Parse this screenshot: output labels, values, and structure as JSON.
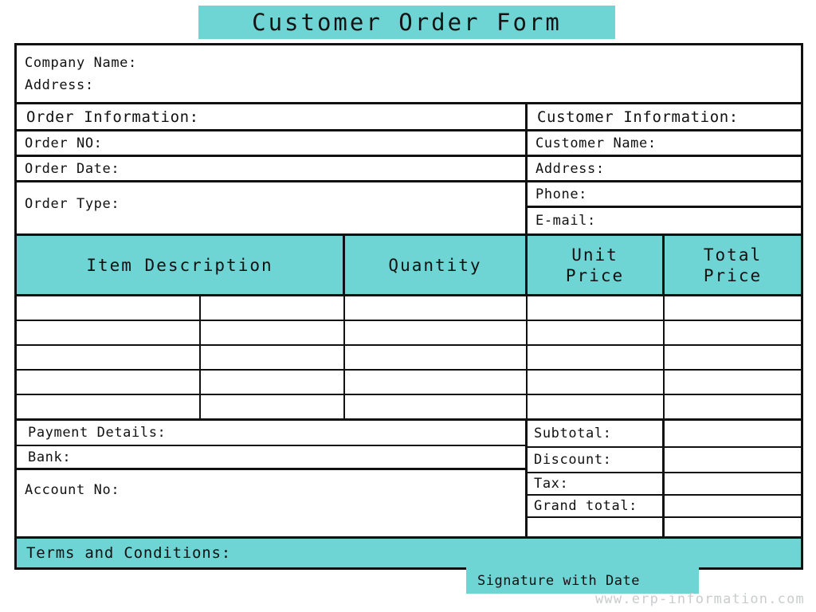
{
  "document": {
    "title": "Customer Order Form",
    "watermark": "www.erp-information.com"
  },
  "colors": {
    "accent_teal": "#6FD4D4",
    "border": "#111111",
    "text": "#111111",
    "watermark": "#c9cccd",
    "background": "#ffffff"
  },
  "company_block": {
    "company_name_label": "Company Name:",
    "address_label": "Address:"
  },
  "order_information": {
    "section_title": "Order Information:",
    "fields": [
      {
        "label": "Order NO:",
        "value": ""
      },
      {
        "label": "Order Date:",
        "value": ""
      },
      {
        "label": "Order Type:",
        "value": ""
      }
    ]
  },
  "customer_information": {
    "section_title": "Customer Information:",
    "fields": [
      {
        "label": "Customer Name:",
        "value": ""
      },
      {
        "label": "Address:",
        "value": ""
      },
      {
        "label": "Phone:",
        "value": ""
      },
      {
        "label": "E-mail:",
        "value": ""
      }
    ]
  },
  "items_table": {
    "headers": [
      "Item Description",
      "Quantity",
      "Unit Price",
      "Total Price"
    ],
    "header_unit_price_line1": "Unit",
    "header_unit_price_line2": "Price",
    "header_total_price_line1": "Total",
    "header_total_price_line2": "Price",
    "row_count": 5,
    "rows": [
      {
        "description_a": "",
        "description_b": "",
        "quantity": "",
        "unit_price": "",
        "total_price": ""
      },
      {
        "description_a": "",
        "description_b": "",
        "quantity": "",
        "unit_price": "",
        "total_price": ""
      },
      {
        "description_a": "",
        "description_b": "",
        "quantity": "",
        "unit_price": "",
        "total_price": ""
      },
      {
        "description_a": "",
        "description_b": "",
        "quantity": "",
        "unit_price": "",
        "total_price": ""
      },
      {
        "description_a": "",
        "description_b": "",
        "quantity": "",
        "unit_price": "",
        "total_price": ""
      }
    ]
  },
  "payment_details": {
    "section_title": "Payment Details:",
    "fields": [
      {
        "label": "Bank:",
        "value": ""
      },
      {
        "label": "Account No:",
        "value": ""
      }
    ]
  },
  "totals": {
    "rows": [
      {
        "label": "Subtotal:",
        "value": ""
      },
      {
        "label": "Discount:",
        "value": ""
      },
      {
        "label": "Tax:",
        "value": ""
      },
      {
        "label": "Grand total:",
        "value": ""
      }
    ]
  },
  "terms": {
    "label": "Terms and Conditions:"
  },
  "signature": {
    "label": "Signature with Date"
  }
}
